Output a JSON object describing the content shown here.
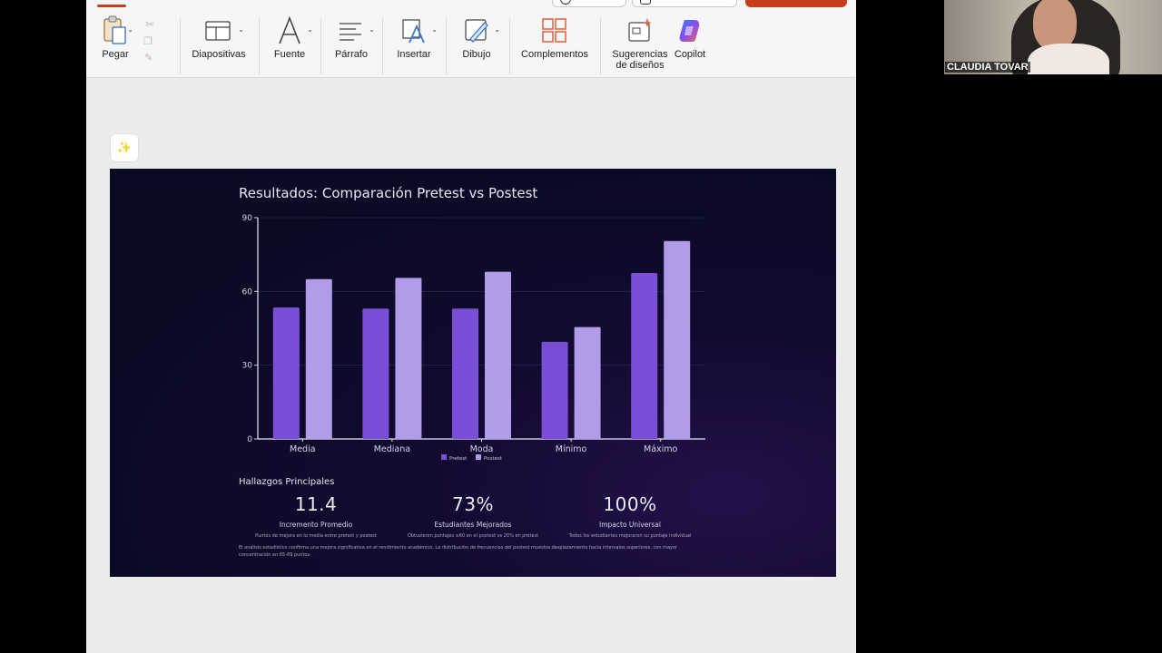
{
  "ribbon": {
    "groups": [
      {
        "id": "paste",
        "label": "Pegar"
      },
      {
        "id": "slides",
        "label": "Diapositivas"
      },
      {
        "id": "font",
        "label": "Fuente"
      },
      {
        "id": "paragraph",
        "label": "Párrafo"
      },
      {
        "id": "insert",
        "label": "Insertar"
      },
      {
        "id": "draw",
        "label": "Dibujo"
      },
      {
        "id": "addins",
        "label": "Complementos"
      },
      {
        "id": "designer",
        "label": "Sugerencias de diseños"
      },
      {
        "id": "copilot",
        "label": "Copilot"
      }
    ]
  },
  "colors": {
    "accent": "#c43e1c",
    "pretest": "#7a4fd8",
    "postest": "#b09ce8",
    "slide_bg": "#0b0a26"
  },
  "slide": {
    "title": "Resultados: Comparación Pretest vs Postest",
    "findings_title": "Hallazgos Principales",
    "stats": [
      {
        "value": "11.4",
        "label": "Incremento Promedio",
        "sub": "Puntos de mejora en la media entre pretest y postest"
      },
      {
        "value": "73%",
        "label": "Estudiantes Mejorados",
        "sub": "Obtuvieron puntajes ≥60 en el postest vs 20% en pretest"
      },
      {
        "value": "100%",
        "label": "Impacto Universal",
        "sub": "Todos los estudiantes mejoraron su puntaje individual"
      }
    ],
    "conclusion": "El análisis estadístico confirma una mejora significativa en el rendimiento académico. La distribución de frecuencias del postest muestra desplazamiento hacia intervalos superiores, con mayor concentración en 65-69 puntos."
  },
  "chart_data": {
    "type": "bar",
    "categories": [
      "Media",
      "Mediana",
      "Moda",
      "Mínimo",
      "Máximo"
    ],
    "series": [
      {
        "name": "Pretest",
        "values": [
          53.5,
          53,
          53,
          39.5,
          67.5
        ],
        "color": "#7a4fd8"
      },
      {
        "name": "Postest",
        "values": [
          65,
          65.5,
          68,
          45.5,
          80.5
        ],
        "color": "#b09ce8"
      }
    ],
    "ylim": [
      0,
      90
    ],
    "yticks": [
      0,
      30,
      60,
      90
    ],
    "grid": true,
    "legend": "bottom"
  },
  "webcam": {
    "name": "CLAUDIA TOVAR"
  }
}
